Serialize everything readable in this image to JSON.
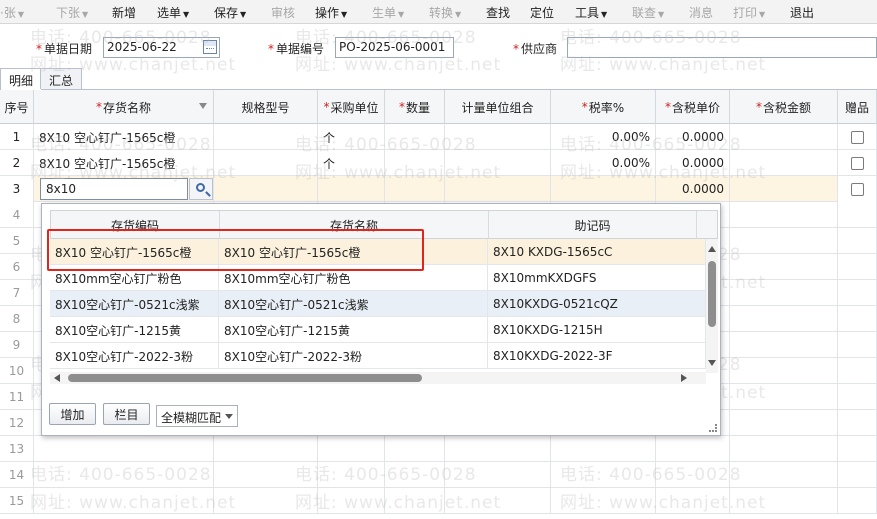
{
  "toolbar": {
    "items": [
      {
        "label": "·张",
        "caret": true,
        "enabled": false
      },
      {
        "label": "下张",
        "caret": true,
        "enabled": false
      },
      {
        "label": "新增",
        "caret": false,
        "enabled": true
      },
      {
        "label": "选单",
        "caret": true,
        "enabled": true
      },
      {
        "label": "保存",
        "caret": true,
        "enabled": true
      },
      {
        "label": "审核",
        "caret": false,
        "enabled": false
      },
      {
        "label": "操作",
        "caret": true,
        "enabled": true
      },
      {
        "label": "生单",
        "caret": true,
        "enabled": false
      },
      {
        "label": "转换",
        "caret": true,
        "enabled": false
      },
      {
        "label": "查找",
        "caret": false,
        "enabled": true
      },
      {
        "label": "定位",
        "caret": false,
        "enabled": true
      },
      {
        "label": "工具",
        "caret": true,
        "enabled": true
      },
      {
        "label": "联查",
        "caret": true,
        "enabled": false
      },
      {
        "label": "消息",
        "caret": false,
        "enabled": false
      },
      {
        "label": "打印",
        "caret": true,
        "enabled": false
      },
      {
        "label": "退出",
        "caret": false,
        "enabled": true
      }
    ]
  },
  "header": {
    "date_label": "单据日期",
    "date_value": "2025-06-22",
    "number_label": "单据编号",
    "number_value": "PO-2025-06-0001",
    "supplier_label": "供应商",
    "supplier_value": ""
  },
  "tabs": [
    "明细",
    "汇总"
  ],
  "grid": {
    "columns": [
      {
        "label": "序号",
        "required": false
      },
      {
        "label": "存货名称",
        "required": true
      },
      {
        "label": "规格型号",
        "required": false
      },
      {
        "label": "采购单位",
        "required": true
      },
      {
        "label": "数量",
        "required": true
      },
      {
        "label": "计量单位组合",
        "required": false
      },
      {
        "label": "税率%",
        "required": true
      },
      {
        "label": "含税单价",
        "required": true
      },
      {
        "label": "含税金额",
        "required": true
      },
      {
        "label": "赠品",
        "required": false
      }
    ],
    "rows": [
      {
        "seq": "1",
        "name": "8X10 空心钉广-1565c橙",
        "unit": "个",
        "tax": "0.00%",
        "price": "0.0000"
      },
      {
        "seq": "2",
        "name": "8X10 空心钉广-1565c橙",
        "unit": "个",
        "tax": "0.00%",
        "price": "0.0000"
      },
      {
        "seq": "3",
        "name": "8x10",
        "unit": "",
        "tax": "",
        "price": "0.0000"
      }
    ],
    "empty_seqs": [
      "4",
      "5",
      "6",
      "7",
      "8",
      "9",
      "10",
      "11",
      "12",
      "13",
      "14",
      "15"
    ]
  },
  "popup": {
    "columns": [
      "存货编码",
      "存货名称",
      "助记码"
    ],
    "rows": [
      {
        "code": "8X10 空心钉广-1565c橙",
        "name": "8X10 空心钉广-1565c橙",
        "mnemonic": "8X10 KXDG-1565cC"
      },
      {
        "code": "8X10mm空心钉广粉色",
        "name": "8X10mm空心钉广粉色",
        "mnemonic": "8X10mmKXDGFS"
      },
      {
        "code": "8X10空心钉广-0521c浅紫",
        "name": "8X10空心钉广-0521c浅紫",
        "mnemonic": "8X10KXDG-0521cQZ"
      },
      {
        "code": "8X10空心钉广-1215黄",
        "name": "8X10空心钉广-1215黄",
        "mnemonic": "8X10KXDG-1215H"
      },
      {
        "code": "8X10空心钉广-2022-3粉",
        "name": "8X10空心钉广-2022-3粉",
        "mnemonic": "8X10KXDG-2022-3F"
      }
    ],
    "add_button": "增加",
    "columns_button": "栏目",
    "match_mode": "全模糊匹配"
  },
  "watermark": {
    "phone": "电话: 400-665-0028",
    "site": "网址: www.chanjet.net"
  },
  "colors": {
    "required": "#d02020",
    "highlight_box": "#e0261c",
    "active_row": "#fdf5e2"
  }
}
